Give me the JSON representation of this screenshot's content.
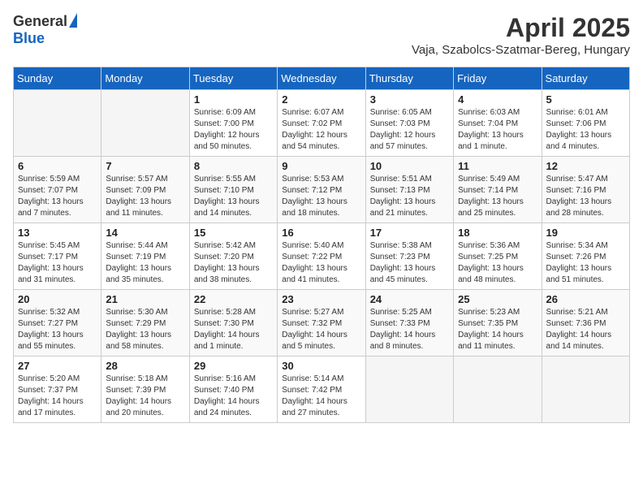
{
  "header": {
    "logo_general": "General",
    "logo_blue": "Blue",
    "month_title": "April 2025",
    "location": "Vaja, Szabolcs-Szatmar-Bereg, Hungary"
  },
  "weekdays": [
    "Sunday",
    "Monday",
    "Tuesday",
    "Wednesday",
    "Thursday",
    "Friday",
    "Saturday"
  ],
  "weeks": [
    [
      {
        "day": "",
        "sunrise": "",
        "sunset": "",
        "daylight": ""
      },
      {
        "day": "",
        "sunrise": "",
        "sunset": "",
        "daylight": ""
      },
      {
        "day": "1",
        "sunrise": "Sunrise: 6:09 AM",
        "sunset": "Sunset: 7:00 PM",
        "daylight": "Daylight: 12 hours and 50 minutes."
      },
      {
        "day": "2",
        "sunrise": "Sunrise: 6:07 AM",
        "sunset": "Sunset: 7:02 PM",
        "daylight": "Daylight: 12 hours and 54 minutes."
      },
      {
        "day": "3",
        "sunrise": "Sunrise: 6:05 AM",
        "sunset": "Sunset: 7:03 PM",
        "daylight": "Daylight: 12 hours and 57 minutes."
      },
      {
        "day": "4",
        "sunrise": "Sunrise: 6:03 AM",
        "sunset": "Sunset: 7:04 PM",
        "daylight": "Daylight: 13 hours and 1 minute."
      },
      {
        "day": "5",
        "sunrise": "Sunrise: 6:01 AM",
        "sunset": "Sunset: 7:06 PM",
        "daylight": "Daylight: 13 hours and 4 minutes."
      }
    ],
    [
      {
        "day": "6",
        "sunrise": "Sunrise: 5:59 AM",
        "sunset": "Sunset: 7:07 PM",
        "daylight": "Daylight: 13 hours and 7 minutes."
      },
      {
        "day": "7",
        "sunrise": "Sunrise: 5:57 AM",
        "sunset": "Sunset: 7:09 PM",
        "daylight": "Daylight: 13 hours and 11 minutes."
      },
      {
        "day": "8",
        "sunrise": "Sunrise: 5:55 AM",
        "sunset": "Sunset: 7:10 PM",
        "daylight": "Daylight: 13 hours and 14 minutes."
      },
      {
        "day": "9",
        "sunrise": "Sunrise: 5:53 AM",
        "sunset": "Sunset: 7:12 PM",
        "daylight": "Daylight: 13 hours and 18 minutes."
      },
      {
        "day": "10",
        "sunrise": "Sunrise: 5:51 AM",
        "sunset": "Sunset: 7:13 PM",
        "daylight": "Daylight: 13 hours and 21 minutes."
      },
      {
        "day": "11",
        "sunrise": "Sunrise: 5:49 AM",
        "sunset": "Sunset: 7:14 PM",
        "daylight": "Daylight: 13 hours and 25 minutes."
      },
      {
        "day": "12",
        "sunrise": "Sunrise: 5:47 AM",
        "sunset": "Sunset: 7:16 PM",
        "daylight": "Daylight: 13 hours and 28 minutes."
      }
    ],
    [
      {
        "day": "13",
        "sunrise": "Sunrise: 5:45 AM",
        "sunset": "Sunset: 7:17 PM",
        "daylight": "Daylight: 13 hours and 31 minutes."
      },
      {
        "day": "14",
        "sunrise": "Sunrise: 5:44 AM",
        "sunset": "Sunset: 7:19 PM",
        "daylight": "Daylight: 13 hours and 35 minutes."
      },
      {
        "day": "15",
        "sunrise": "Sunrise: 5:42 AM",
        "sunset": "Sunset: 7:20 PM",
        "daylight": "Daylight: 13 hours and 38 minutes."
      },
      {
        "day": "16",
        "sunrise": "Sunrise: 5:40 AM",
        "sunset": "Sunset: 7:22 PM",
        "daylight": "Daylight: 13 hours and 41 minutes."
      },
      {
        "day": "17",
        "sunrise": "Sunrise: 5:38 AM",
        "sunset": "Sunset: 7:23 PM",
        "daylight": "Daylight: 13 hours and 45 minutes."
      },
      {
        "day": "18",
        "sunrise": "Sunrise: 5:36 AM",
        "sunset": "Sunset: 7:25 PM",
        "daylight": "Daylight: 13 hours and 48 minutes."
      },
      {
        "day": "19",
        "sunrise": "Sunrise: 5:34 AM",
        "sunset": "Sunset: 7:26 PM",
        "daylight": "Daylight: 13 hours and 51 minutes."
      }
    ],
    [
      {
        "day": "20",
        "sunrise": "Sunrise: 5:32 AM",
        "sunset": "Sunset: 7:27 PM",
        "daylight": "Daylight: 13 hours and 55 minutes."
      },
      {
        "day": "21",
        "sunrise": "Sunrise: 5:30 AM",
        "sunset": "Sunset: 7:29 PM",
        "daylight": "Daylight: 13 hours and 58 minutes."
      },
      {
        "day": "22",
        "sunrise": "Sunrise: 5:28 AM",
        "sunset": "Sunset: 7:30 PM",
        "daylight": "Daylight: 14 hours and 1 minute."
      },
      {
        "day": "23",
        "sunrise": "Sunrise: 5:27 AM",
        "sunset": "Sunset: 7:32 PM",
        "daylight": "Daylight: 14 hours and 5 minutes."
      },
      {
        "day": "24",
        "sunrise": "Sunrise: 5:25 AM",
        "sunset": "Sunset: 7:33 PM",
        "daylight": "Daylight: 14 hours and 8 minutes."
      },
      {
        "day": "25",
        "sunrise": "Sunrise: 5:23 AM",
        "sunset": "Sunset: 7:35 PM",
        "daylight": "Daylight: 14 hours and 11 minutes."
      },
      {
        "day": "26",
        "sunrise": "Sunrise: 5:21 AM",
        "sunset": "Sunset: 7:36 PM",
        "daylight": "Daylight: 14 hours and 14 minutes."
      }
    ],
    [
      {
        "day": "27",
        "sunrise": "Sunrise: 5:20 AM",
        "sunset": "Sunset: 7:37 PM",
        "daylight": "Daylight: 14 hours and 17 minutes."
      },
      {
        "day": "28",
        "sunrise": "Sunrise: 5:18 AM",
        "sunset": "Sunset: 7:39 PM",
        "daylight": "Daylight: 14 hours and 20 minutes."
      },
      {
        "day": "29",
        "sunrise": "Sunrise: 5:16 AM",
        "sunset": "Sunset: 7:40 PM",
        "daylight": "Daylight: 14 hours and 24 minutes."
      },
      {
        "day": "30",
        "sunrise": "Sunrise: 5:14 AM",
        "sunset": "Sunset: 7:42 PM",
        "daylight": "Daylight: 14 hours and 27 minutes."
      },
      {
        "day": "",
        "sunrise": "",
        "sunset": "",
        "daylight": ""
      },
      {
        "day": "",
        "sunrise": "",
        "sunset": "",
        "daylight": ""
      },
      {
        "day": "",
        "sunrise": "",
        "sunset": "",
        "daylight": ""
      }
    ]
  ]
}
